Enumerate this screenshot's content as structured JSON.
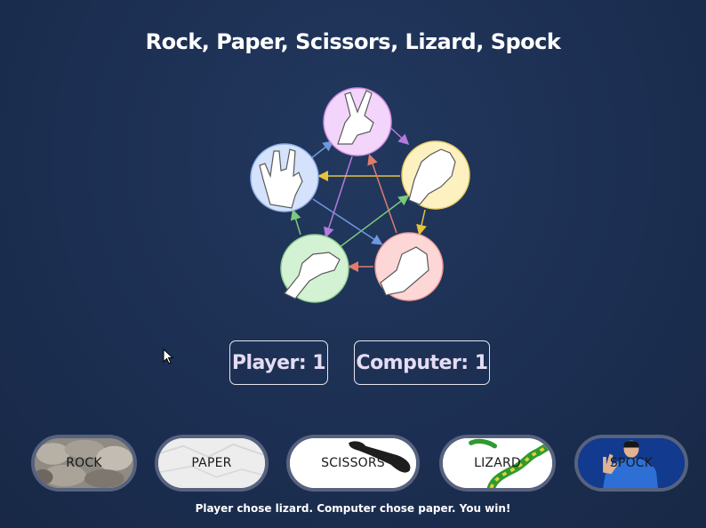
{
  "title": "Rock, Paper, Scissors, Lizard, Spock",
  "diagram": {
    "nodes": [
      {
        "key": "scissors",
        "icon": "scissors-hand-icon",
        "color": "#f3d4fb",
        "stroke": "#c88fe0"
      },
      {
        "key": "paper",
        "icon": "paper-hand-icon",
        "color": "#fdf1c2",
        "stroke": "#e8cc66"
      },
      {
        "key": "rock",
        "icon": "rock-hand-icon",
        "color": "#fdd6d6",
        "stroke": "#ee9c9c"
      },
      {
        "key": "lizard",
        "icon": "lizard-hand-icon",
        "color": "#d3f1d3",
        "stroke": "#8fd08f"
      },
      {
        "key": "spock",
        "icon": "spock-hand-icon",
        "color": "#d4e2fb",
        "stroke": "#8fb0ea"
      }
    ]
  },
  "scores": {
    "player_label": "Player: 1",
    "computer_label": "Computer: 1"
  },
  "choices": [
    {
      "key": "rock",
      "label": "ROCK"
    },
    {
      "key": "paper",
      "label": "PAPER"
    },
    {
      "key": "scissors",
      "label": "SCISSORS"
    },
    {
      "key": "lizard",
      "label": "LIZARD"
    },
    {
      "key": "spock",
      "label": "SPOCK"
    }
  ],
  "result_text": "Player chose lizard. Computer chose paper. You win!",
  "colors": {
    "background": "#1c2f52",
    "score_text": "#e5dcf2",
    "button_border": "#56627e"
  }
}
